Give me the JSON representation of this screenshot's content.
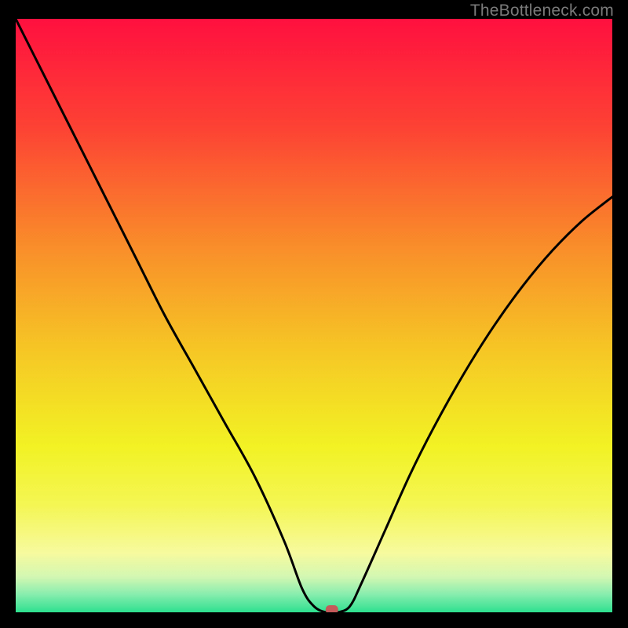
{
  "watermark": "TheBottleneck.com",
  "chart_data": {
    "type": "line",
    "title": "",
    "xlabel": "",
    "ylabel": "",
    "xlim": [
      0,
      100
    ],
    "ylim": [
      0,
      100
    ],
    "grid": false,
    "legend": false,
    "background_gradient": {
      "stops": [
        {
          "offset": 0.0,
          "color": "#ff103f"
        },
        {
          "offset": 0.18,
          "color": "#fd4134"
        },
        {
          "offset": 0.38,
          "color": "#f98c2a"
        },
        {
          "offset": 0.55,
          "color": "#f6c425"
        },
        {
          "offset": 0.72,
          "color": "#f2f224"
        },
        {
          "offset": 0.82,
          "color": "#f4f654"
        },
        {
          "offset": 0.9,
          "color": "#f7fa9e"
        },
        {
          "offset": 0.94,
          "color": "#d3f7b2"
        },
        {
          "offset": 0.97,
          "color": "#87edae"
        },
        {
          "offset": 1.0,
          "color": "#2de08e"
        }
      ]
    },
    "series": [
      {
        "name": "bottleneck-curve",
        "x": [
          0,
          5,
          10,
          15,
          20,
          25,
          30,
          35,
          40,
          45,
          48,
          50,
          52,
          54,
          56,
          58,
          62,
          66,
          70,
          75,
          80,
          85,
          90,
          95,
          100
        ],
        "values": [
          100,
          90,
          80,
          70,
          60,
          50,
          41,
          32,
          23,
          12,
          4,
          1,
          0,
          0,
          1,
          5,
          14,
          23,
          31,
          40,
          48,
          55,
          61,
          66,
          70
        ]
      }
    ],
    "marker": {
      "x": 53,
      "y": 0,
      "color": "#c55a5a"
    }
  }
}
